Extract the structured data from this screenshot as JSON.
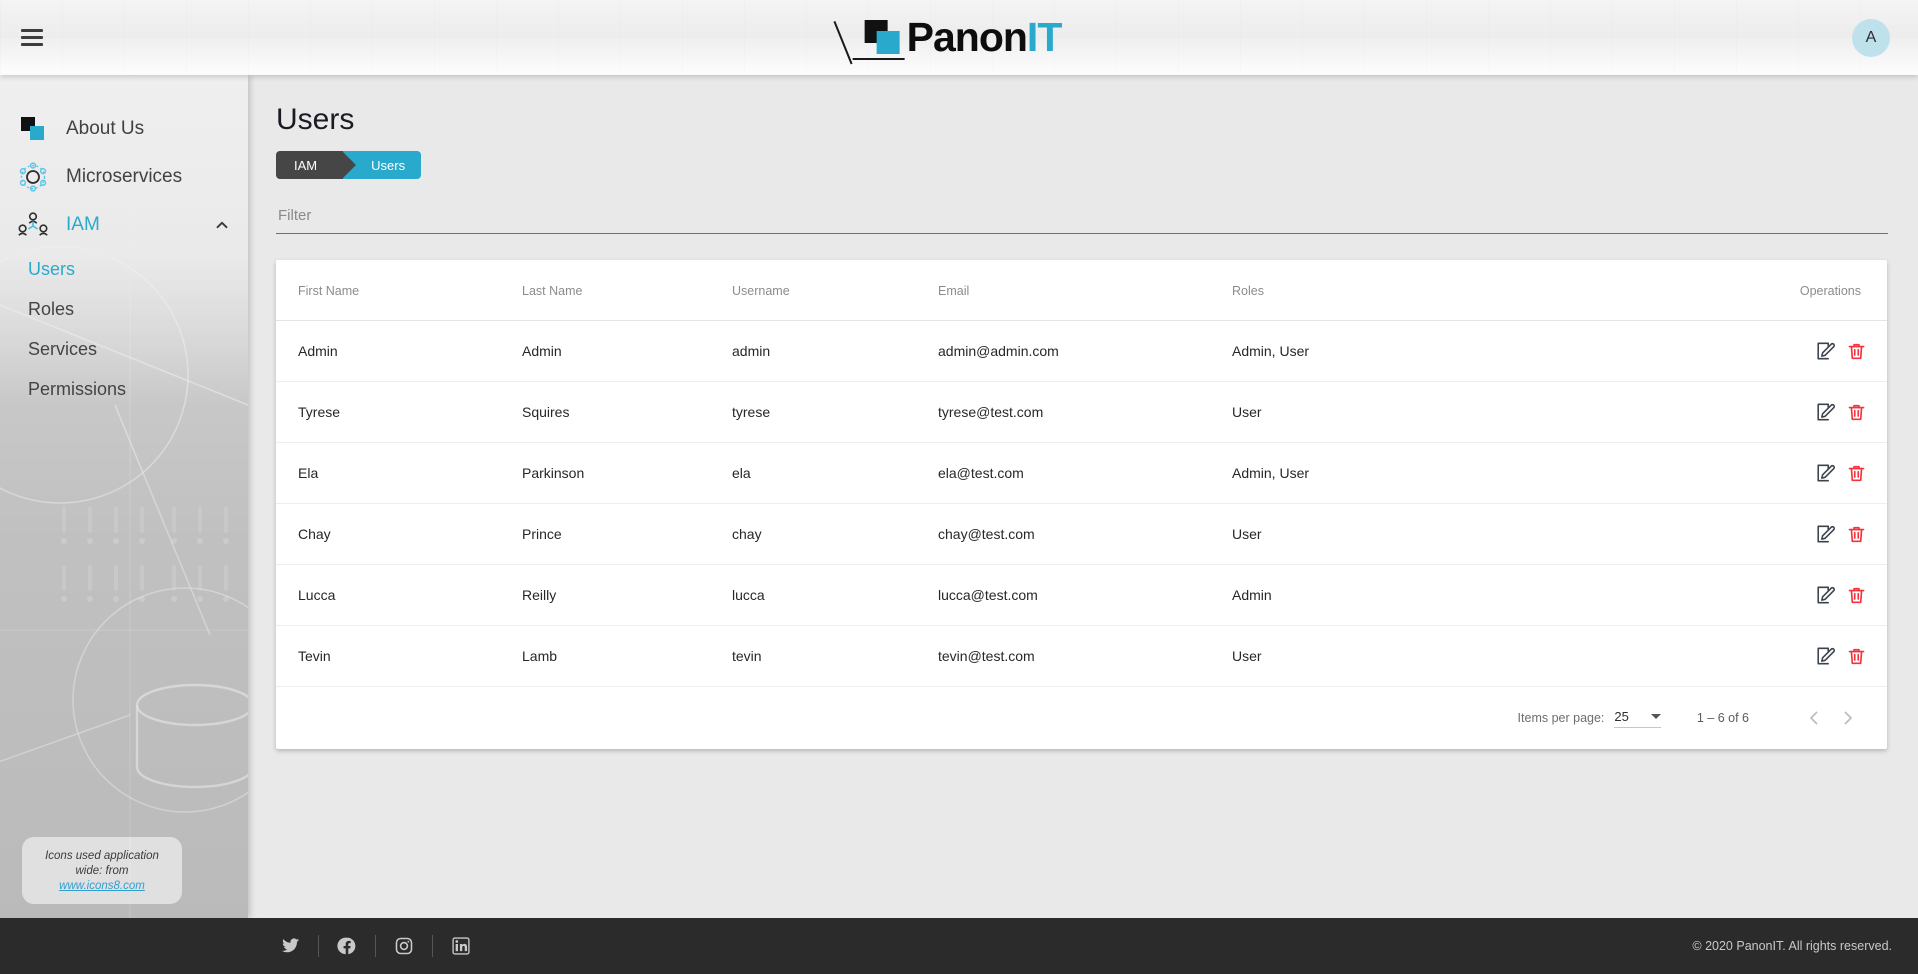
{
  "header": {
    "menu_icon": "hamburger-icon",
    "logo_text_dark": "Panon",
    "logo_text_teal": "IT",
    "avatar_initial": "A"
  },
  "sidebar": {
    "items": [
      {
        "label": "About Us",
        "icon": "squares-icon",
        "active": false
      },
      {
        "label": "Microservices",
        "icon": "microservices-icon",
        "active": false
      },
      {
        "label": "IAM",
        "icon": "users-group-icon",
        "active": true,
        "expanded": true
      }
    ],
    "sub_items": [
      {
        "label": "Users",
        "active": true
      },
      {
        "label": "Roles",
        "active": false
      },
      {
        "label": "Services",
        "active": false
      },
      {
        "label": "Permissions",
        "active": false
      }
    ],
    "note_line1": "Icons used application wide: from",
    "note_link": "www.icons8.com"
  },
  "main": {
    "page_title": "Users",
    "breadcrumb": [
      "IAM",
      "Users"
    ],
    "filter_placeholder": "Filter",
    "filter_value": "",
    "table": {
      "columns": [
        "First Name",
        "Last Name",
        "Username",
        "Email",
        "Roles",
        "Operations"
      ],
      "rows": [
        {
          "first_name": "Admin",
          "last_name": "Admin",
          "username": "admin",
          "email": "admin@admin.com",
          "roles": "Admin, User"
        },
        {
          "first_name": "Tyrese",
          "last_name": "Squires",
          "username": "tyrese",
          "email": "tyrese@test.com",
          "roles": "User"
        },
        {
          "first_name": "Ela",
          "last_name": "Parkinson",
          "username": "ela",
          "email": "ela@test.com",
          "roles": "Admin, User"
        },
        {
          "first_name": "Chay",
          "last_name": "Prince",
          "username": "chay",
          "email": "chay@test.com",
          "roles": "User"
        },
        {
          "first_name": "Lucca",
          "last_name": "Reilly",
          "username": "lucca",
          "email": "lucca@test.com",
          "roles": "Admin"
        },
        {
          "first_name": "Tevin",
          "last_name": "Lamb",
          "username": "tevin",
          "email": "tevin@test.com",
          "roles": "User"
        }
      ]
    },
    "paginator": {
      "items_per_page_label": "Items per page:",
      "items_per_page_value": "25",
      "range_label": "1 – 6 of 6"
    }
  },
  "footer": {
    "socials": [
      "twitter-icon",
      "facebook-icon",
      "instagram-icon",
      "linkedin-icon"
    ],
    "copyright": "© 2020 PanonIT. All rights reserved."
  },
  "colors": {
    "accent_teal": "#29aacd",
    "breadcrumb_dark": "#464646",
    "delete_red": "#f5333f",
    "footer_dark": "#2b2b2b"
  }
}
